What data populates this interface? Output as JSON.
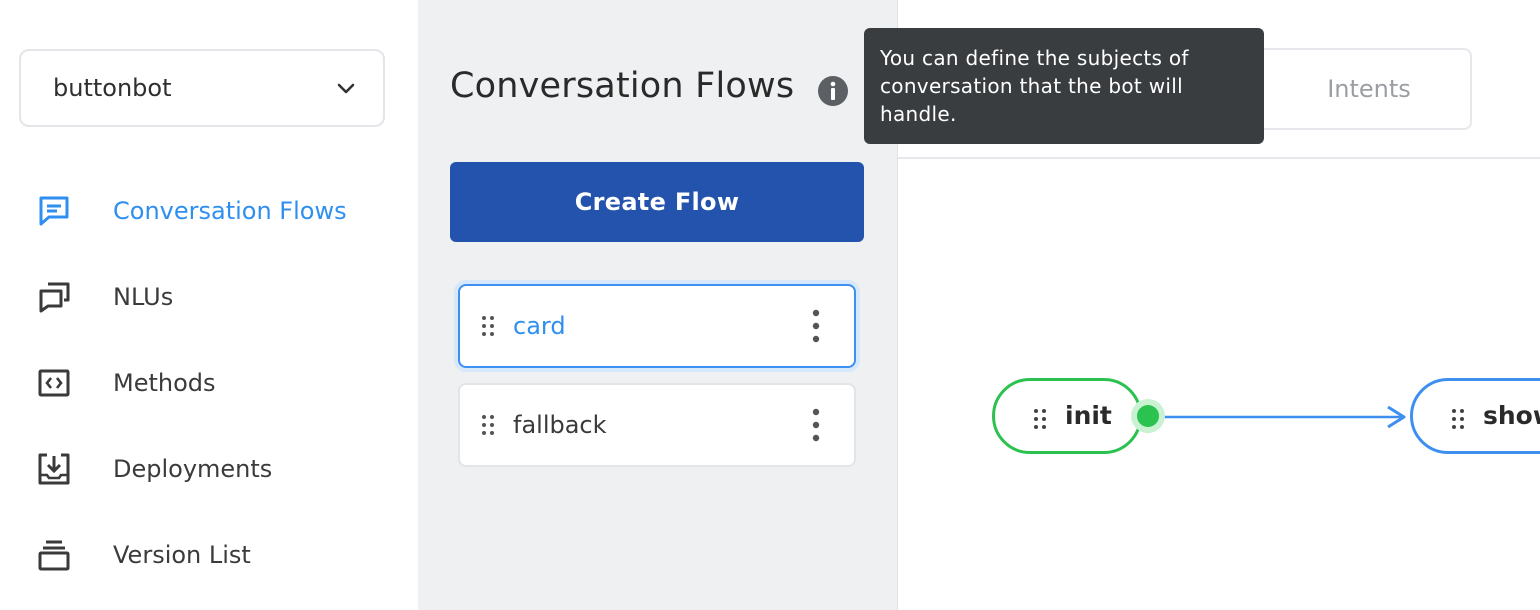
{
  "sidebar": {
    "bot_name": "buttonbot",
    "items": [
      {
        "label": "Conversation Flows",
        "icon": "chat-bubble-icon",
        "active": true
      },
      {
        "label": "NLUs",
        "icon": "stacked-chat-icon",
        "active": false
      },
      {
        "label": "Methods",
        "icon": "code-brackets-icon",
        "active": false
      },
      {
        "label": "Deployments",
        "icon": "download-tray-icon",
        "active": false
      },
      {
        "label": "Version List",
        "icon": "stack-layers-icon",
        "active": false
      }
    ]
  },
  "panel": {
    "title": "Conversation Flows",
    "create_button": "Create Flow",
    "flows": [
      {
        "label": "card",
        "selected": true
      },
      {
        "label": "fallback",
        "selected": false
      }
    ]
  },
  "canvas": {
    "tabs": {
      "intents": "Intents"
    },
    "nodes": [
      {
        "label": "init",
        "color": "#2cc24f"
      },
      {
        "label": "show",
        "color": "#3d8ff0"
      }
    ]
  },
  "tooltip": {
    "text": "You can define the subjects of conversation that the bot will handle."
  },
  "colors": {
    "accent": "#2f8ff0",
    "primary_button": "#2453ad",
    "init_node": "#2cc24f",
    "tooltip_bg": "#3a3d40"
  }
}
